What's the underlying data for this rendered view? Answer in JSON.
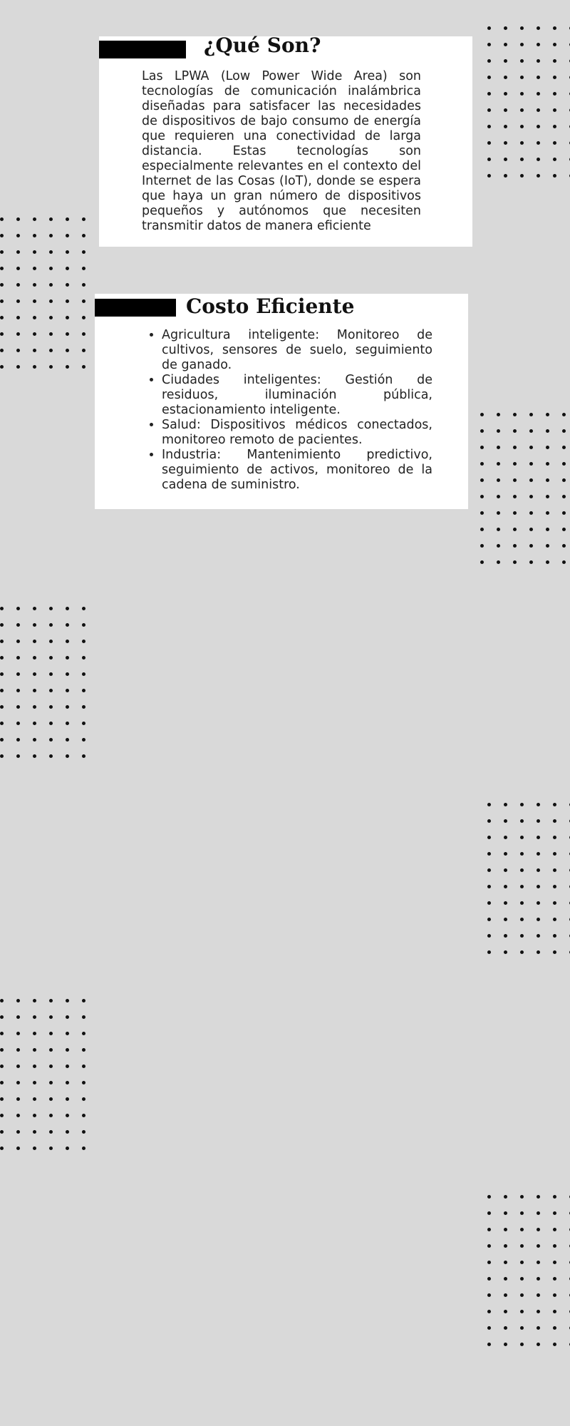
{
  "sections": {
    "que_son": {
      "title": "¿Qué Son?",
      "body": "Las LPWA (Low Power Wide Area) son tecnologías de comunicación inalámbrica diseñadas para satisfacer las necesidades de dispositivos de bajo consumo de energía que requieren una conectividad de larga distancia. Estas tecnologías son especialmente relevantes en el contexto del Internet de las Cosas (IoT), donde se espera que haya un gran número de dispositivos pequeños y autónomos que necesiten transmitir datos de manera eficiente"
    },
    "costo_eficiente": {
      "title": "Costo Eficiente",
      "items": [
        "Agricultura inteligente: Monitoreo de cultivos, sensores de suelo, seguimiento de ganado.",
        "Ciudades inteligentes: Gestión de residuos, iluminación pública, estacionamiento inteligente.",
        "Salud: Dispositivos médicos conectados, monitoreo remoto de pacientes.",
        "Industria: Mantenimiento predictivo, seguimiento de activos, monitoreo de la cadena de suministro."
      ]
    }
  },
  "colors": {
    "background": "#d9d9d9",
    "card": "#ffffff",
    "accent_bar": "#000000",
    "dots": "#111111"
  }
}
